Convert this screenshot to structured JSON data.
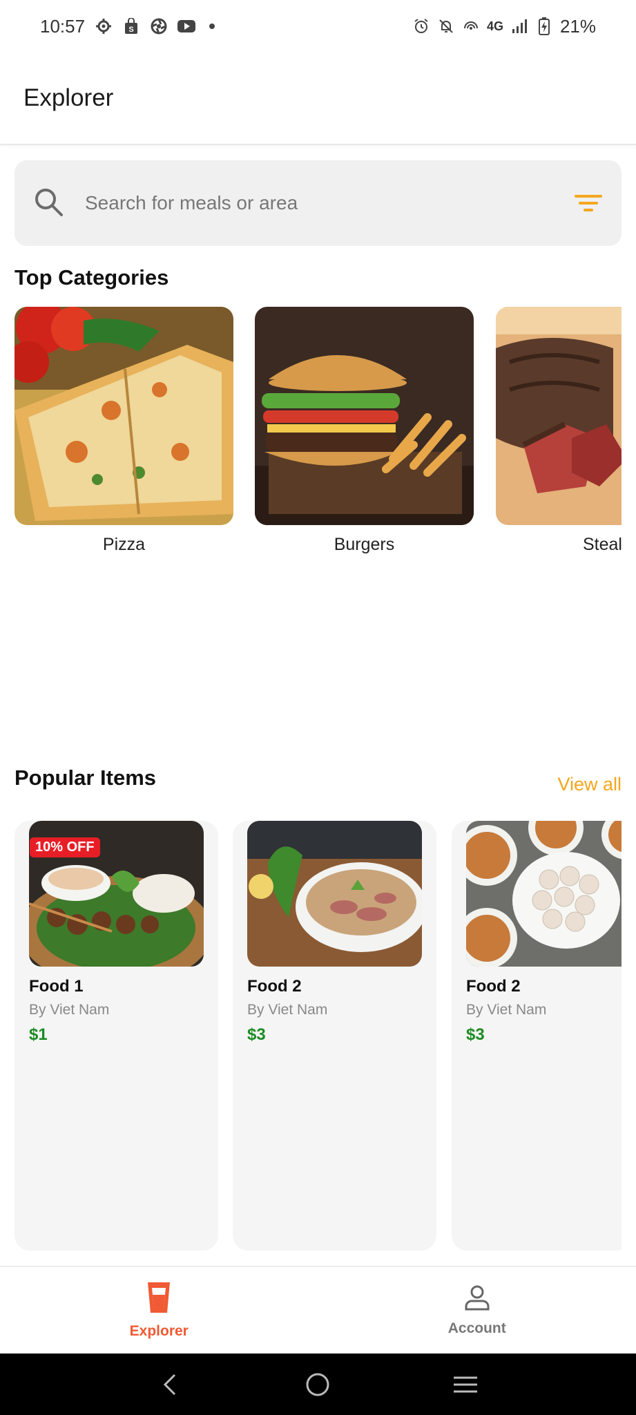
{
  "status_bar": {
    "time": "10:57",
    "network": "4G",
    "battery": "21%",
    "left_icons": [
      "settings-icon",
      "shopping-bag-icon",
      "pinwheel-icon",
      "youtube-icon",
      "dot-icon"
    ],
    "right_icons": [
      "alarm-icon",
      "mute-icon",
      "hotspot-icon",
      "signal-icon",
      "battery-icon"
    ]
  },
  "app_bar": {
    "title": "Explorer"
  },
  "search": {
    "placeholder": "Search for meals or area",
    "value": ""
  },
  "categories": {
    "title": "Top Categories",
    "items": [
      {
        "label": "Pizza"
      },
      {
        "label": "Burgers"
      },
      {
        "label": "Steal"
      }
    ]
  },
  "popular": {
    "title": "Popular Items",
    "view_all": "View all",
    "items": [
      {
        "name": "Food 1",
        "by": "By Viet Nam",
        "price": "$1",
        "badge": "10% OFF"
      },
      {
        "name": "Food 2",
        "by": "By Viet Nam",
        "price": "$3"
      },
      {
        "name": "Food 2",
        "by": "By Viet Nam",
        "price": "$3"
      }
    ]
  },
  "bottom_nav": {
    "items": [
      {
        "label": "Explorer",
        "icon": "drink-cup-icon",
        "active": true
      },
      {
        "label": "Account",
        "icon": "person-icon",
        "active": false
      }
    ]
  },
  "colors": {
    "accent": "#f05a34",
    "view_all": "#f4a71d",
    "price": "#1d8b24",
    "badge": "#e81e26"
  }
}
